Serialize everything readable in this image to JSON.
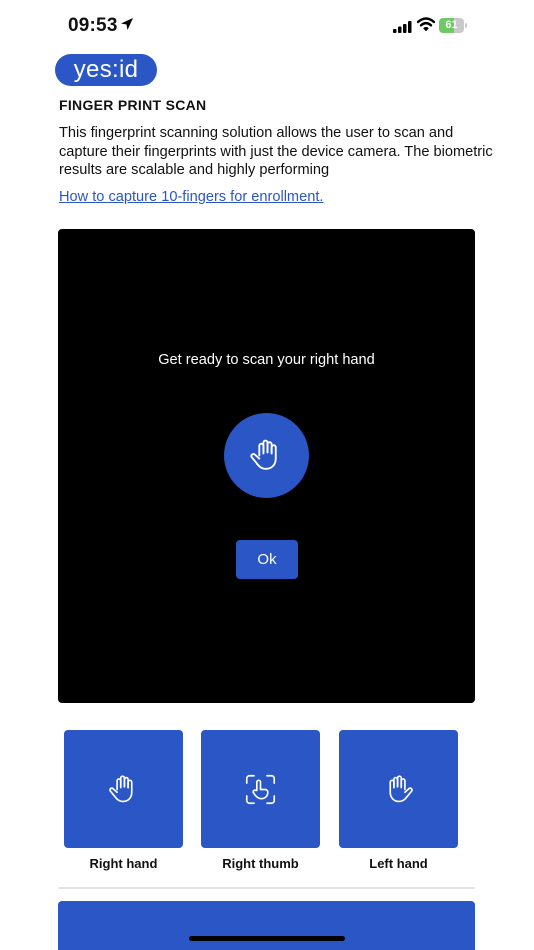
{
  "status_bar": {
    "time": "09:53",
    "battery_level": "61",
    "battery_fraction": 0.61,
    "icons": [
      "location-arrow-icon",
      "cellular-signal-icon",
      "wifi-icon",
      "battery-icon"
    ]
  },
  "brand": {
    "logo_text": "yes:id",
    "accent_color": "#2a56c6"
  },
  "section": {
    "title": "FINGER PRINT SCAN",
    "description": "This fingerprint scanning solution allows the user to scan and capture their fingerprints with just the device camera. The biometric results are scalable and highly performing",
    "link": "How to capture 10-fingers for enrollment."
  },
  "camera": {
    "prompt": "Get ready to scan your right hand",
    "icon": "raised-hand-icon",
    "ok_label": "Ok"
  },
  "options": [
    {
      "label": "Right hand",
      "icon": "right-hand-icon"
    },
    {
      "label": "Right thumb",
      "icon": "thumb-scan-icon"
    },
    {
      "label": "Left hand",
      "icon": "left-hand-icon"
    }
  ]
}
